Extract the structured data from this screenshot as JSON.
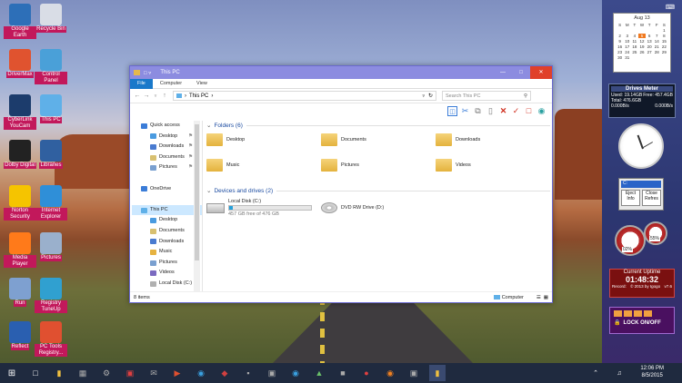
{
  "desktop_icons": [
    {
      "label": "Google Earth",
      "color": "#2d6fb8"
    },
    {
      "label": "Recycle Bin",
      "color": "#d9dde6"
    },
    {
      "label": "DriverMax",
      "color": "#e0532f"
    },
    {
      "label": "Control Panel",
      "color": "#4aa0d8"
    },
    {
      "label": "CyberLink YouCam",
      "color": "#1c3c6c"
    },
    {
      "label": "This PC",
      "color": "#5fb0e8"
    },
    {
      "label": "Dolby Digital",
      "color": "#222222"
    },
    {
      "label": "Libraries",
      "color": "#3060a0"
    },
    {
      "label": "Norton Security",
      "color": "#f5c400"
    },
    {
      "label": "Internet Explorer",
      "color": "#2f8fd8"
    },
    {
      "label": "Media Player",
      "color": "#ff7a1a"
    },
    {
      "label": "Pictures",
      "color": "#9ab0cc"
    },
    {
      "label": "Run",
      "color": "#7ea0d0"
    },
    {
      "label": "Registry TuneUp",
      "color": "#30a0d0"
    },
    {
      "label": "Reflect",
      "color": "#2a5fb0"
    },
    {
      "label": "PC Tools Registry...",
      "color": "#e05030"
    }
  ],
  "window": {
    "title": "This PC",
    "minimize": "—",
    "maximize": "□",
    "close": "✕",
    "tabs": [
      "File",
      "Computer",
      "View"
    ],
    "address": "This PC",
    "search_placeholder": "Search This PC",
    "nav": [
      {
        "label": "Quick access",
        "color": "#3b7dd8"
      },
      {
        "label": "Desktop",
        "color": "#4a9be0"
      },
      {
        "label": "Downloads",
        "color": "#4a7bd0"
      },
      {
        "label": "Documents",
        "color": "#d8c070"
      },
      {
        "label": "Pictures",
        "color": "#7aa0d0"
      },
      {
        "label": "",
        "color": ""
      },
      {
        "label": "OneDrive",
        "color": "#3b7dd8"
      },
      {
        "label": "",
        "color": ""
      },
      {
        "label": "This PC",
        "color": "#5fb0e8"
      },
      {
        "label": "Desktop",
        "color": "#4a9be0"
      },
      {
        "label": "Documents",
        "color": "#d8c070"
      },
      {
        "label": "Downloads",
        "color": "#4a7bd0"
      },
      {
        "label": "Music",
        "color": "#e6b240"
      },
      {
        "label": "Pictures",
        "color": "#7aa0d0"
      },
      {
        "label": "Videos",
        "color": "#7a6ac0"
      },
      {
        "label": "Local Disk (C:)",
        "color": "#b0b0b0"
      }
    ],
    "folders_header": "Folders (6)",
    "folders": [
      "Desktop",
      "Documents",
      "Downloads",
      "Music",
      "Pictures",
      "Videos"
    ],
    "drives_header": "Devices and drives (2)",
    "drives": [
      {
        "name": "Local Disk (C:)",
        "free": "457 GB free of 476 GB",
        "used_fraction": 0.04
      },
      {
        "name": "DVD RW Drive (D:)"
      }
    ],
    "status_left": "8 items",
    "status_right": "Computer"
  },
  "gadgets": {
    "calendar_month": "Aug 13",
    "drives_meter_title": "Drives Meter",
    "drives_used": "Used: 19.14GB",
    "drives_free": "Free: 457.4GB",
    "drives_total": "Total: 476.6GB",
    "drives_rate": "0.000B/s",
    "eject_label": "Eject Info",
    "close_label": "Close Refres",
    "eject_drive": "C:",
    "uptime_title": "Current Uptime",
    "uptime_value": "01:48:32",
    "uptime_record": "Record:",
    "uptime_credit": "© 2013 by Igogo",
    "uptime_version": "v7.6",
    "lock_label": "LOCK ON/OFF",
    "meter1": "02%",
    "meter2": "55%"
  },
  "taskbar": {
    "time": "12:06 PM",
    "date": "8/5/2015"
  }
}
